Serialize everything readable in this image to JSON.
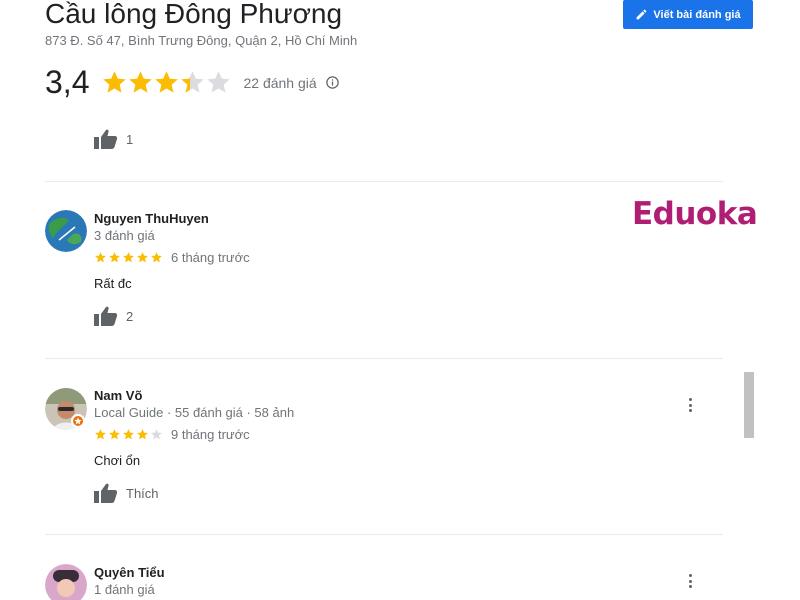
{
  "place": {
    "title": "Cầu lông Đông Phương",
    "address": "873 Đ. Số 47, Bình Trưng Đông, Quận 2, Hồ Chí Minh"
  },
  "write_review_button": {
    "label": "Viết bài đánh giá",
    "icon": "pencil-icon"
  },
  "summary": {
    "rating": "3,4",
    "rating_value": 3.4,
    "review_count": "22 đánh giá",
    "info_icon": "info-icon"
  },
  "top_partial_review": {
    "likes": "1"
  },
  "reviews": [
    {
      "name": "Nguyen ThuHuyen",
      "meta": "3 đánh giá",
      "stars": 5,
      "time": "6 tháng trước",
      "text": "Rất đc",
      "likes": "2"
    },
    {
      "name": "Nam Võ",
      "meta": "Local Guide · 55 đánh giá · 58 ảnh",
      "stars": 4,
      "time": "9 tháng trước",
      "text": "Chơi ổn",
      "like_label": "Thích"
    },
    {
      "name": "Quyên Tiểu",
      "meta": "1 đánh giá"
    }
  ],
  "watermark": "Eduoka",
  "colors": {
    "star": "#fbbc04",
    "star_empty": "#dadce0",
    "button": "#1a73e8",
    "watermark": "#b01d74"
  }
}
